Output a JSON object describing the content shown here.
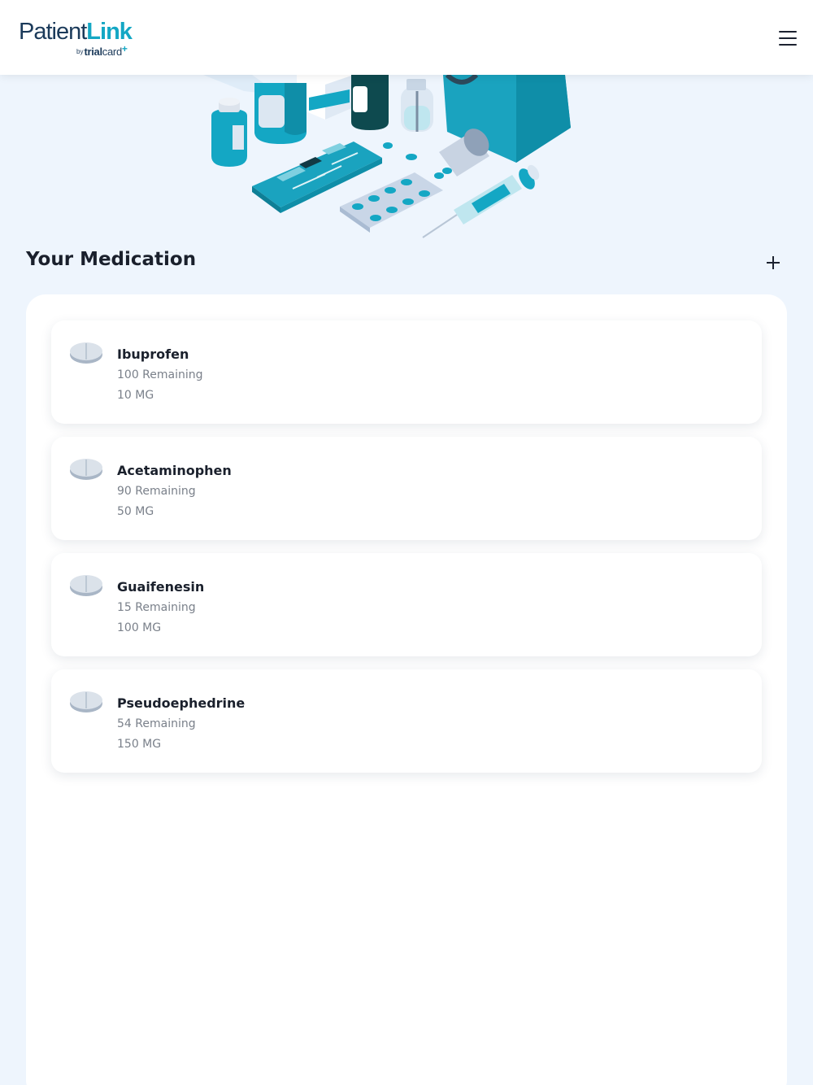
{
  "header": {
    "logo": {
      "patient": "Patient",
      "link": "Link",
      "by": "by",
      "trial": "trial",
      "card": "card",
      "plus": "+"
    },
    "menu_icon": "hamburger-menu-icon"
  },
  "hero": {
    "illustration": "medication-illustration"
  },
  "section": {
    "title": "Your Medication",
    "add_icon": "plus-icon"
  },
  "medications": [
    {
      "name": "Ibuprofen",
      "remaining": "100 Remaining",
      "dose": "10 MG",
      "icon": "pill-icon"
    },
    {
      "name": "Acetaminophen",
      "remaining": "90 Remaining",
      "dose": "50 MG",
      "icon": "pill-icon"
    },
    {
      "name": "Guaifenesin",
      "remaining": "15 Remaining",
      "dose": "100 MG",
      "icon": "pill-icon"
    },
    {
      "name": "Pseudoephedrine",
      "remaining": "54 Remaining",
      "dose": "150 MG",
      "icon": "pill-icon"
    }
  ],
  "colors": {
    "accent": "#14a7c4",
    "brand_dark": "#1b3a5a",
    "background": "#eef5fd"
  }
}
